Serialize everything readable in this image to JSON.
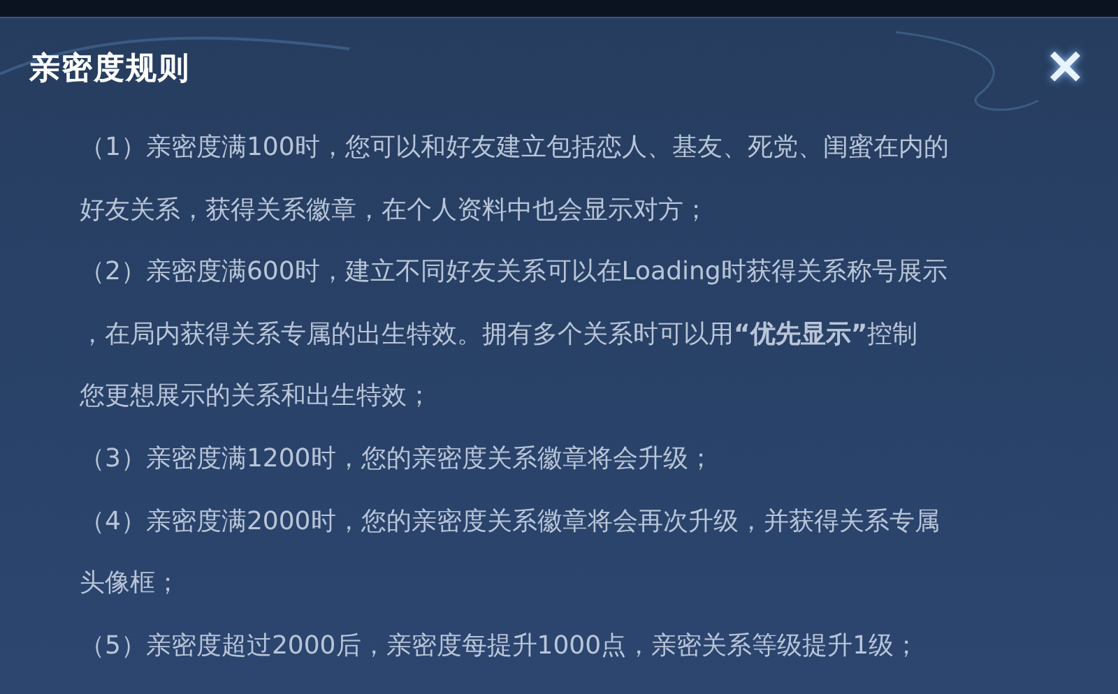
{
  "dialog": {
    "title": "亲密度规则",
    "close": "✕",
    "rules": [
      {
        "lines": [
          "（1）亲密度满100时，您可以和好友建立包括恋人、基友、死党、闺蜜在内的",
          "好友关系，获得关系徽章，在个人资料中也会显示对方；"
        ]
      },
      {
        "lines": [
          "（2）亲密度满600时，建立不同好友关系可以在Loading时获得关系称号展示",
          "，在局内获得关系专属的出生特效。拥有多个关系时可以用**“优先显示”**控制",
          "您更想展示的关系和出生特效；"
        ]
      },
      {
        "lines": [
          "（3）亲密度满1200时，您的亲密度关系徽章将会升级；"
        ]
      },
      {
        "lines": [
          "（4）亲密度满2000时，您的亲密度关系徽章将会再次升级，并获得关系专属",
          "头像框；"
        ]
      },
      {
        "lines": [
          "（5）亲密度超过2000后，亲密度每提升1000点，亲密关系等级提升1级；"
        ]
      }
    ]
  }
}
